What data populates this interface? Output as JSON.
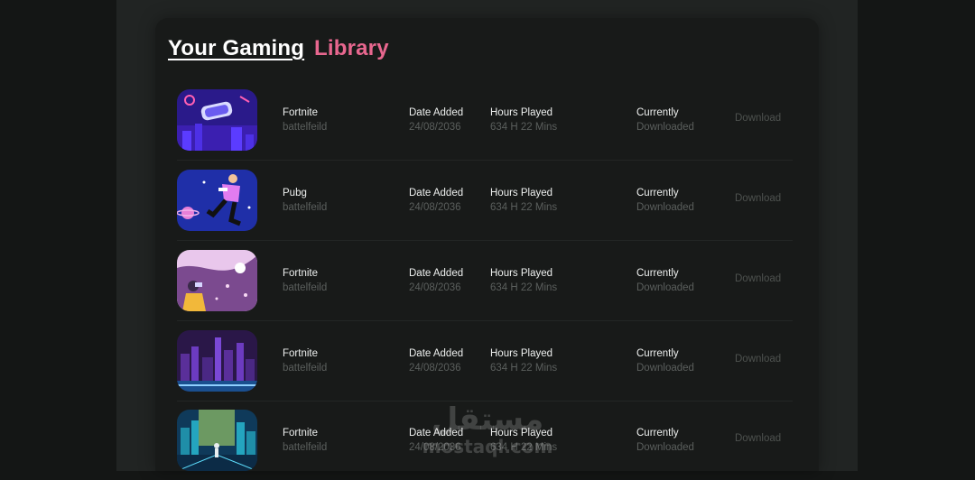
{
  "header": {
    "title_white": "Your Gaming",
    "title_pink": "Library"
  },
  "colors": {
    "accent_pink": "#e8678f",
    "background": "#181a19",
    "muted_text": "#5b5f5d"
  },
  "games": [
    {
      "name": "Fortnite",
      "subtitle": "battelfeild",
      "date_label": "Date Added",
      "date": "24/08/2036",
      "hours_label": "Hours Played",
      "hours": "634 H 22 Mins",
      "status_label": "Currently",
      "status": "Downloaded",
      "action": "Download"
    },
    {
      "name": "Pubg",
      "subtitle": "battelfeild",
      "date_label": "Date Added",
      "date": "24/08/2036",
      "hours_label": "Hours Played",
      "hours": "634 H 22 Mins",
      "status_label": "Currently",
      "status": "Downloaded",
      "action": "Download"
    },
    {
      "name": "Fortnite",
      "subtitle": "battelfeild",
      "date_label": "Date Added",
      "date": "24/08/2036",
      "hours_label": "Hours Played",
      "hours": "634 H 22 Mins",
      "status_label": "Currently",
      "status": "Downloaded",
      "action": "Download"
    },
    {
      "name": "Fortnite",
      "subtitle": "battelfeild",
      "date_label": "Date Added",
      "date": "24/08/2036",
      "hours_label": "Hours Played",
      "hours": "634 H 22 Mins",
      "status_label": "Currently",
      "status": "Downloaded",
      "action": "Download"
    },
    {
      "name": "Fortnite",
      "subtitle": "battelfeild",
      "date_label": "Date Added",
      "date": "24/08/2036",
      "hours_label": "Hours Played",
      "hours": "634 H 22 Mins",
      "status_label": "Currently",
      "status": "Downloaded",
      "action": "Download"
    }
  ],
  "watermark": {
    "arabic": "مستقل",
    "latin": "mostaql.com"
  }
}
